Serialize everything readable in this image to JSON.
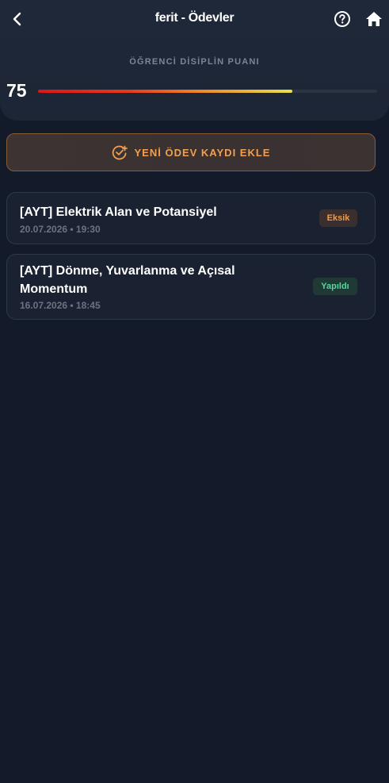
{
  "header": {
    "title": "ferit - Ödevler",
    "back_icon": "chevron-left-icon",
    "help_icon": "help-circle-icon",
    "home_icon": "home-icon"
  },
  "discipline": {
    "label": "ÖĞRENCİ DİSİPLİN PUANI",
    "score": "75",
    "progress_fraction": 0.75
  },
  "add_button": {
    "label": "YENİ ÖDEV KAYDI EKLE",
    "icon": "check-circle-plus-icon",
    "accent_color": "#f0a050"
  },
  "assignments": [
    {
      "title": "[AYT] Elektrik Alan ve Potansiyel",
      "date": "20.07.2026 • 19:30",
      "status": "Eksik",
      "status_color": "#f09a45"
    },
    {
      "title": "[AYT] Dönme, Yuvarlanma ve Açısal Momentum",
      "date": "16.07.2026 • 18:45",
      "status": "Yapıldı",
      "status_color": "#56d6a0"
    }
  ],
  "colors": {
    "background": "#131a2a",
    "header_bg": "#1f2838",
    "card_bg": "#1a2232"
  }
}
